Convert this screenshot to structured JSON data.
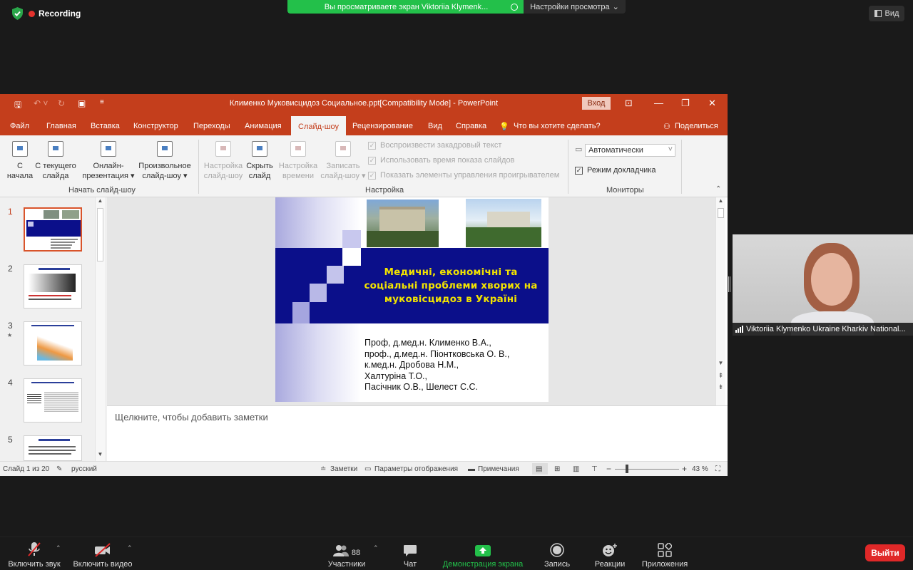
{
  "zoom_top": {
    "recording_label": "Recording",
    "share_banner_text": "Вы просматриваете экран Viktoriia Klymenk...",
    "view_options_label": "Настройки просмотра",
    "view_button_label": "Вид"
  },
  "ppt": {
    "window_title": "Клименко Муковисцидоз Социальное.ppt[Compatibility Mode]  -  PowerPoint",
    "signin_label": "Вход",
    "tabs": [
      "Файл",
      "Главная",
      "Вставка",
      "Конструктор",
      "Переходы",
      "Анимация",
      "Слайд-шоу",
      "Рецензирование",
      "Вид",
      "Справка"
    ],
    "active_tab_index": 6,
    "tell_me": "Что вы хотите сделать?",
    "share_label": "Поделиться",
    "ribbon": {
      "start_group": {
        "label": "Начать слайд-шоу",
        "from_start": [
          "С",
          "начала"
        ],
        "from_current": [
          "С текущего",
          "слайда"
        ],
        "online": [
          "Онлайн-",
          "презентация ▾"
        ],
        "custom": [
          "Произвольное",
          "слайд-шоу ▾"
        ]
      },
      "setup_group": {
        "label": "Настройка",
        "setup_show": [
          "Настройка",
          "слайд-шоу"
        ],
        "hide_slide": [
          "Скрыть",
          "слайд"
        ],
        "rehearse": [
          "Настройка",
          "времени"
        ],
        "record": [
          "Записать",
          "слайд-шоу ▾"
        ],
        "checkboxes": [
          "Воспроизвести закадровый текст",
          "Использовать время показа слайдов",
          "Показать элементы управления проигрывателем"
        ]
      },
      "monitors_group": {
        "label": "Мониторы",
        "monitor_value": "Автоматически",
        "presenter_view": "Режим докладчика"
      }
    },
    "slide_numbers": [
      "1",
      "2",
      "3",
      "4",
      "5"
    ],
    "slide": {
      "title_lines": [
        "Медичні, економічні та",
        "соціальні проблеми хворих на",
        "муковісцидоз в Україні"
      ],
      "authors": [
        "Проф, д.мед.н. Клименко В.А.,",
        "проф., д.мед.н. Піонтковська О. В.,",
        "к.мед.н. Дробова Н.М.,",
        "Халтуріна Т.О.,",
        "Пасічник О.В., Шелест С.С."
      ],
      "colors": {
        "band": "#0b0f8a",
        "title": "#f2e300"
      }
    },
    "notes_placeholder": "Щелкните, чтобы добавить заметки",
    "status": {
      "slide_counter": "Слайд 1 из 20",
      "language": "русский",
      "notes": "Заметки",
      "display_settings": "Параметры отображения",
      "comments": "Примечания",
      "zoom": "43 %"
    }
  },
  "participant": {
    "name": "Viktoriia Klymenko Ukraine Kharkiv National..."
  },
  "zoom_bar": {
    "unmute": "Включить звук",
    "start_video": "Включить видео",
    "participants": "Участники",
    "participants_count": "88",
    "chat": "Чат",
    "share_screen": "Демонстрация экрана",
    "record": "Запись",
    "reactions": "Реакции",
    "apps": "Приложения",
    "leave": "Выйти"
  }
}
